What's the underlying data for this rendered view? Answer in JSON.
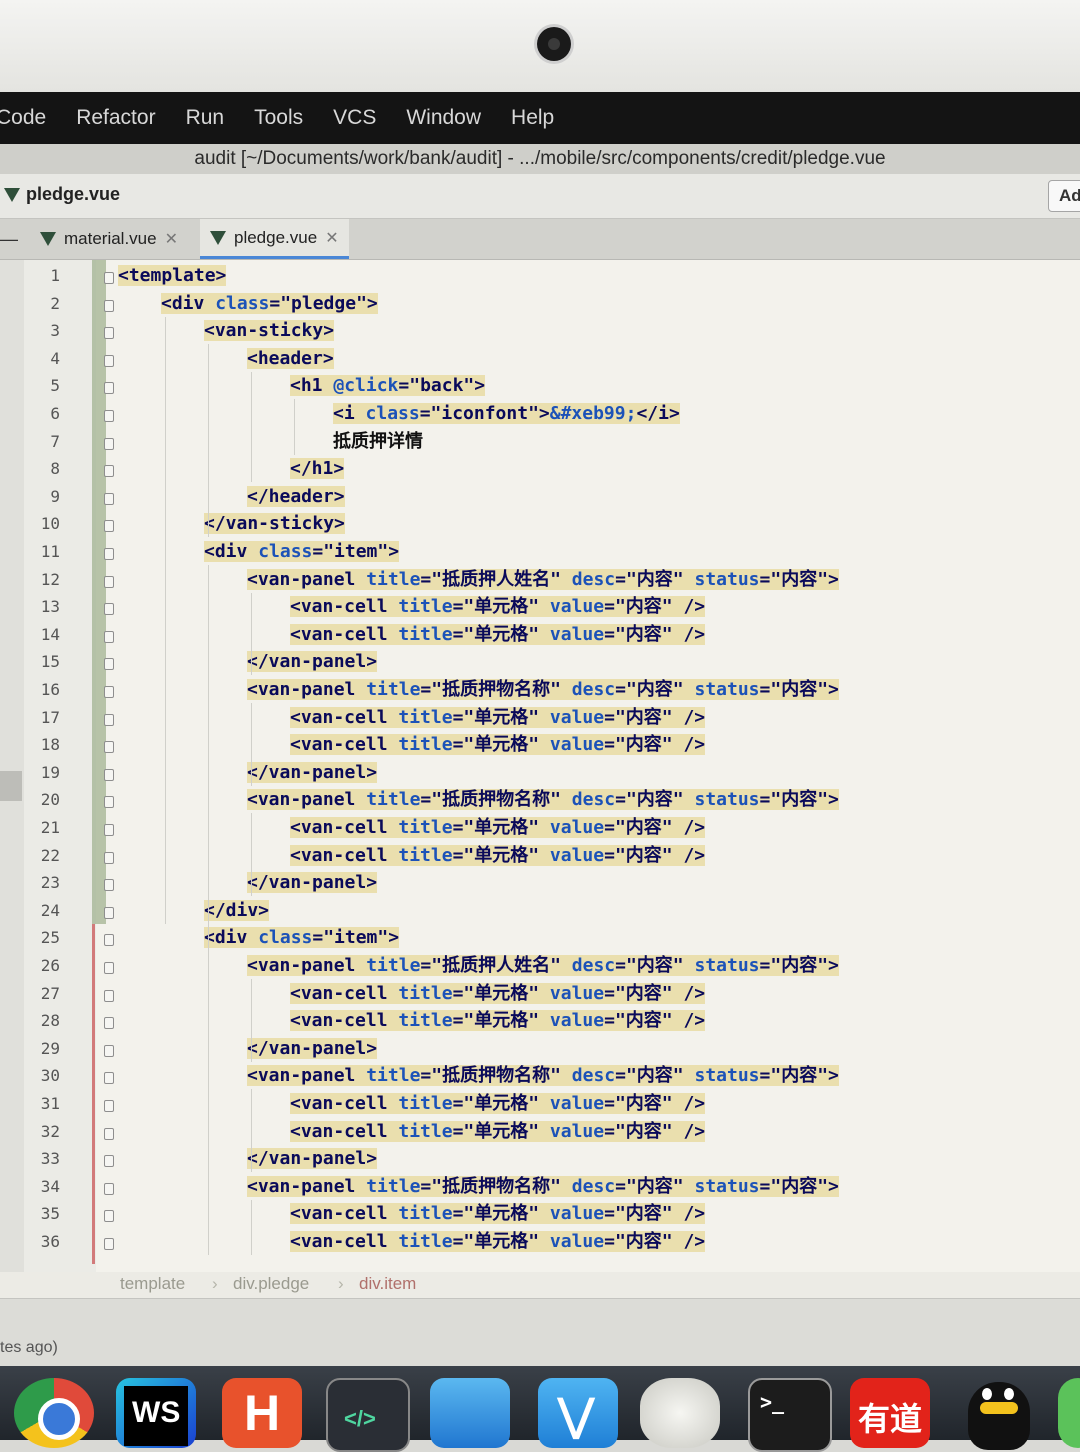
{
  "menu": [
    "Code",
    "Refactor",
    "Run",
    "Tools",
    "VCS",
    "Window",
    "Help"
  ],
  "window_title": "audit [~/Documents/work/bank/audit] - .../mobile/src/components/credit/pledge.vue",
  "nav": {
    "file": "pledge.vue",
    "add_label": "Ad"
  },
  "tabs": [
    {
      "label": "material.vue",
      "active": false
    },
    {
      "label": "pledge.vue",
      "active": true
    }
  ],
  "editor": {
    "lines": [
      {
        "n": "1",
        "indent": 0,
        "segs": [
          {
            "t": "<template>",
            "c": "tag"
          }
        ]
      },
      {
        "n": "2",
        "indent": 1,
        "segs": [
          {
            "t": "<div ",
            "c": "tag"
          },
          {
            "t": "class",
            "c": "attr"
          },
          {
            "t": "=\"pledge\">",
            "c": "tag"
          }
        ]
      },
      {
        "n": "3",
        "indent": 2,
        "segs": [
          {
            "t": "<van-sticky>",
            "c": "tag"
          }
        ]
      },
      {
        "n": "4",
        "indent": 3,
        "segs": [
          {
            "t": "<header>",
            "c": "tag"
          }
        ]
      },
      {
        "n": "5",
        "indent": 4,
        "segs": [
          {
            "t": "<h1 ",
            "c": "tag"
          },
          {
            "t": "@click",
            "c": "attr"
          },
          {
            "t": "=\"back\">",
            "c": "tag"
          }
        ]
      },
      {
        "n": "6",
        "indent": 5,
        "segs": [
          {
            "t": "<i ",
            "c": "tag"
          },
          {
            "t": "class",
            "c": "attr"
          },
          {
            "t": "=\"iconfont\">",
            "c": "tag"
          },
          {
            "t": "&#xeb99;",
            "c": "ent"
          },
          {
            "t": "</i>",
            "c": "tag"
          }
        ]
      },
      {
        "n": "7",
        "indent": 5,
        "segs": [
          {
            "t": "抵质押详情",
            "c": "txt"
          }
        ]
      },
      {
        "n": "8",
        "indent": 4,
        "segs": [
          {
            "t": "</h1>",
            "c": "tag"
          }
        ]
      },
      {
        "n": "9",
        "indent": 3,
        "segs": [
          {
            "t": "</header>",
            "c": "tag"
          }
        ]
      },
      {
        "n": "10",
        "indent": 2,
        "segs": [
          {
            "t": "</van-sticky>",
            "c": "tag"
          }
        ]
      },
      {
        "n": "11",
        "indent": 2,
        "segs": [
          {
            "t": "<div ",
            "c": "tag"
          },
          {
            "t": "class",
            "c": "attr"
          },
          {
            "t": "=\"item\">",
            "c": "tag"
          }
        ]
      },
      {
        "n": "12",
        "indent": 3,
        "segs": [
          {
            "t": "<van-panel ",
            "c": "tag"
          },
          {
            "t": "title",
            "c": "attr"
          },
          {
            "t": "=\"抵质押人姓名\" ",
            "c": "tag"
          },
          {
            "t": "desc",
            "c": "attr"
          },
          {
            "t": "=\"内容\" ",
            "c": "tag"
          },
          {
            "t": "status",
            "c": "attr"
          },
          {
            "t": "=\"内容\">",
            "c": "tag"
          }
        ]
      },
      {
        "n": "13",
        "indent": 4,
        "segs": [
          {
            "t": "<van-cell ",
            "c": "tag"
          },
          {
            "t": "title",
            "c": "attr"
          },
          {
            "t": "=\"单元格\" ",
            "c": "tag"
          },
          {
            "t": "value",
            "c": "attr"
          },
          {
            "t": "=\"内容\" />",
            "c": "tag"
          }
        ]
      },
      {
        "n": "14",
        "indent": 4,
        "segs": [
          {
            "t": "<van-cell ",
            "c": "tag"
          },
          {
            "t": "title",
            "c": "attr"
          },
          {
            "t": "=\"单元格\" ",
            "c": "tag"
          },
          {
            "t": "value",
            "c": "attr"
          },
          {
            "t": "=\"内容\" />",
            "c": "tag"
          }
        ]
      },
      {
        "n": "15",
        "indent": 3,
        "segs": [
          {
            "t": "</van-panel>",
            "c": "tag"
          }
        ]
      },
      {
        "n": "16",
        "indent": 3,
        "segs": [
          {
            "t": "<van-panel ",
            "c": "tag"
          },
          {
            "t": "title",
            "c": "attr"
          },
          {
            "t": "=\"抵质押物名称\" ",
            "c": "tag"
          },
          {
            "t": "desc",
            "c": "attr"
          },
          {
            "t": "=\"内容\" ",
            "c": "tag"
          },
          {
            "t": "status",
            "c": "attr"
          },
          {
            "t": "=\"内容\">",
            "c": "tag"
          }
        ]
      },
      {
        "n": "17",
        "indent": 4,
        "segs": [
          {
            "t": "<van-cell ",
            "c": "tag"
          },
          {
            "t": "title",
            "c": "attr"
          },
          {
            "t": "=\"单元格\" ",
            "c": "tag"
          },
          {
            "t": "value",
            "c": "attr"
          },
          {
            "t": "=\"内容\" />",
            "c": "tag"
          }
        ]
      },
      {
        "n": "18",
        "indent": 4,
        "segs": [
          {
            "t": "<van-cell ",
            "c": "tag"
          },
          {
            "t": "title",
            "c": "attr"
          },
          {
            "t": "=\"单元格\" ",
            "c": "tag"
          },
          {
            "t": "value",
            "c": "attr"
          },
          {
            "t": "=\"内容\" />",
            "c": "tag"
          }
        ]
      },
      {
        "n": "19",
        "indent": 3,
        "segs": [
          {
            "t": "</van-panel>",
            "c": "tag"
          }
        ]
      },
      {
        "n": "20",
        "indent": 3,
        "segs": [
          {
            "t": "<van-panel ",
            "c": "tag"
          },
          {
            "t": "title",
            "c": "attr"
          },
          {
            "t": "=\"抵质押物名称\" ",
            "c": "tag"
          },
          {
            "t": "desc",
            "c": "attr"
          },
          {
            "t": "=\"内容\" ",
            "c": "tag"
          },
          {
            "t": "status",
            "c": "attr"
          },
          {
            "t": "=\"内容\">",
            "c": "tag"
          }
        ]
      },
      {
        "n": "21",
        "indent": 4,
        "segs": [
          {
            "t": "<van-cell ",
            "c": "tag"
          },
          {
            "t": "title",
            "c": "attr"
          },
          {
            "t": "=\"单元格\" ",
            "c": "tag"
          },
          {
            "t": "value",
            "c": "attr"
          },
          {
            "t": "=\"内容\" />",
            "c": "tag"
          }
        ]
      },
      {
        "n": "22",
        "indent": 4,
        "segs": [
          {
            "t": "<van-cell ",
            "c": "tag"
          },
          {
            "t": "title",
            "c": "attr"
          },
          {
            "t": "=\"单元格\" ",
            "c": "tag"
          },
          {
            "t": "value",
            "c": "attr"
          },
          {
            "t": "=\"内容\" />",
            "c": "tag"
          }
        ]
      },
      {
        "n": "23",
        "indent": 3,
        "segs": [
          {
            "t": "</van-panel>",
            "c": "tag"
          }
        ]
      },
      {
        "n": "24",
        "indent": 2,
        "segs": [
          {
            "t": "</div>",
            "c": "tag"
          }
        ]
      },
      {
        "n": "25",
        "indent": 2,
        "segs": [
          {
            "t": "<div ",
            "c": "tag"
          },
          {
            "t": "class",
            "c": "attr"
          },
          {
            "t": "=\"item\">",
            "c": "tag"
          }
        ]
      },
      {
        "n": "26",
        "indent": 3,
        "segs": [
          {
            "t": "<van-panel ",
            "c": "tag"
          },
          {
            "t": "title",
            "c": "attr"
          },
          {
            "t": "=\"抵质押人姓名\" ",
            "c": "tag"
          },
          {
            "t": "desc",
            "c": "attr"
          },
          {
            "t": "=\"内容\" ",
            "c": "tag"
          },
          {
            "t": "status",
            "c": "attr"
          },
          {
            "t": "=\"内容\">",
            "c": "tag"
          }
        ]
      },
      {
        "n": "27",
        "indent": 4,
        "segs": [
          {
            "t": "<van-cell ",
            "c": "tag"
          },
          {
            "t": "title",
            "c": "attr"
          },
          {
            "t": "=\"单元格\" ",
            "c": "tag"
          },
          {
            "t": "value",
            "c": "attr"
          },
          {
            "t": "=\"内容\" />",
            "c": "tag"
          }
        ]
      },
      {
        "n": "28",
        "indent": 4,
        "segs": [
          {
            "t": "<van-cell ",
            "c": "tag"
          },
          {
            "t": "title",
            "c": "attr"
          },
          {
            "t": "=\"单元格\" ",
            "c": "tag"
          },
          {
            "t": "value",
            "c": "attr"
          },
          {
            "t": "=\"内容\" />",
            "c": "tag"
          }
        ]
      },
      {
        "n": "29",
        "indent": 3,
        "segs": [
          {
            "t": "</van-panel>",
            "c": "tag"
          }
        ]
      },
      {
        "n": "30",
        "indent": 3,
        "segs": [
          {
            "t": "<van-panel ",
            "c": "tag"
          },
          {
            "t": "title",
            "c": "attr"
          },
          {
            "t": "=\"抵质押物名称\" ",
            "c": "tag"
          },
          {
            "t": "desc",
            "c": "attr"
          },
          {
            "t": "=\"内容\" ",
            "c": "tag"
          },
          {
            "t": "status",
            "c": "attr"
          },
          {
            "t": "=\"内容\">",
            "c": "tag"
          }
        ]
      },
      {
        "n": "31",
        "indent": 4,
        "segs": [
          {
            "t": "<van-cell ",
            "c": "tag"
          },
          {
            "t": "title",
            "c": "attr"
          },
          {
            "t": "=\"单元格\" ",
            "c": "tag"
          },
          {
            "t": "value",
            "c": "attr"
          },
          {
            "t": "=\"内容\" />",
            "c": "tag"
          }
        ]
      },
      {
        "n": "32",
        "indent": 4,
        "segs": [
          {
            "t": "<van-cell ",
            "c": "tag"
          },
          {
            "t": "title",
            "c": "attr"
          },
          {
            "t": "=\"单元格\" ",
            "c": "tag"
          },
          {
            "t": "value",
            "c": "attr"
          },
          {
            "t": "=\"内容\" />",
            "c": "tag"
          }
        ]
      },
      {
        "n": "33",
        "indent": 3,
        "segs": [
          {
            "t": "</van-panel>",
            "c": "tag"
          }
        ]
      },
      {
        "n": "34",
        "indent": 3,
        "segs": [
          {
            "t": "<van-panel ",
            "c": "tag"
          },
          {
            "t": "title",
            "c": "attr"
          },
          {
            "t": "=\"抵质押物名称\" ",
            "c": "tag"
          },
          {
            "t": "desc",
            "c": "attr"
          },
          {
            "t": "=\"内容\" ",
            "c": "tag"
          },
          {
            "t": "status",
            "c": "attr"
          },
          {
            "t": "=\"内容\">",
            "c": "tag"
          }
        ]
      },
      {
        "n": "35",
        "indent": 4,
        "segs": [
          {
            "t": "<van-cell ",
            "c": "tag"
          },
          {
            "t": "title",
            "c": "attr"
          },
          {
            "t": "=\"单元格\" ",
            "c": "tag"
          },
          {
            "t": "value",
            "c": "attr"
          },
          {
            "t": "=\"内容\" />",
            "c": "tag"
          }
        ]
      },
      {
        "n": "36",
        "indent": 4,
        "segs": [
          {
            "t": "<van-cell ",
            "c": "tag"
          },
          {
            "t": "title",
            "c": "attr"
          },
          {
            "t": "=\"单元格\" ",
            "c": "tag"
          },
          {
            "t": "value",
            "c": "attr"
          },
          {
            "t": "=\"内容\" />",
            "c": "tag"
          }
        ]
      }
    ]
  },
  "breadcrumb": [
    "template",
    "div.pledge",
    "div.item"
  ],
  "status": {
    "text": "tes ago)"
  },
  "dock": [
    {
      "icon": "chrome-icon"
    },
    {
      "icon": "webstorm-icon",
      "label": "WS"
    },
    {
      "icon": "hbuilder-icon",
      "label": "H"
    },
    {
      "icon": "code-editor-icon",
      "label": "</>"
    },
    {
      "icon": "xcode-icon"
    },
    {
      "icon": "vscode-icon"
    },
    {
      "icon": "pitcher-app-icon"
    },
    {
      "icon": "terminal-icon",
      "label": ">_"
    },
    {
      "icon": "youdao-icon",
      "label": "有道"
    },
    {
      "icon": "qq-icon"
    }
  ],
  "colors": {
    "tag": "#0a0a5a",
    "attr": "#1c52b8",
    "highlight": "#eadfae",
    "menubar": "#141414"
  }
}
